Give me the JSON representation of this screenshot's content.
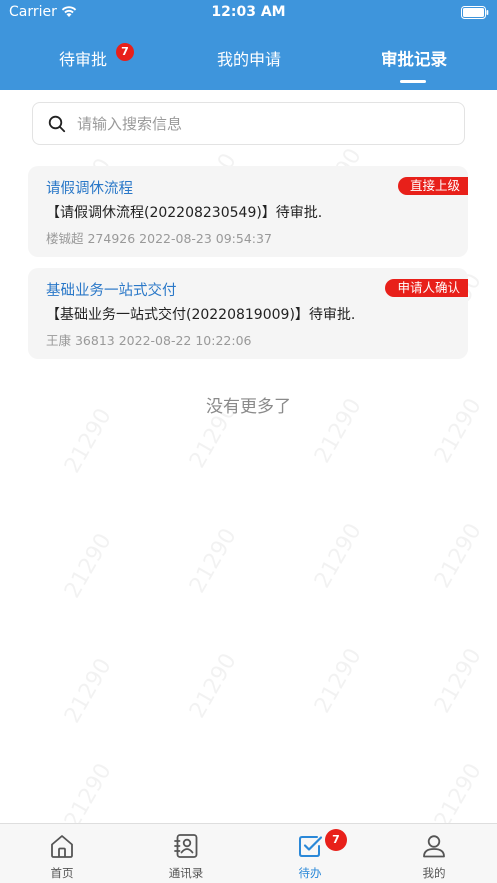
{
  "status_bar": {
    "carrier": "Carrier",
    "time": "12:03 AM"
  },
  "tabs": [
    {
      "label": "待审批",
      "badge": "7"
    },
    {
      "label": "我的申请"
    },
    {
      "label": "审批记录",
      "active": true
    }
  ],
  "search": {
    "placeholder": "请输入搜索信息",
    "value": ""
  },
  "records": [
    {
      "title": "请假调休流程",
      "tag": "直接上级",
      "description": "【请假调休流程(202208230549)】待审批.",
      "meta": "楼铖超 274926 2022-08-23 09:54:37"
    },
    {
      "title": "基础业务一站式交付",
      "tag": "申请人确认",
      "description": "【基础业务一站式交付(20220819009)】待审批.",
      "meta": "王康 36813 2022-08-22 10:22:06"
    }
  ],
  "no_more_text": "没有更多了",
  "watermark_text": "21290",
  "bottom_nav": [
    {
      "label": "首页",
      "icon": "home-icon"
    },
    {
      "label": "通讯录",
      "icon": "contacts-icon"
    },
    {
      "label": "待办",
      "icon": "todo-check-icon",
      "active": true,
      "badge": "7"
    },
    {
      "label": "我的",
      "icon": "profile-icon"
    }
  ],
  "colors": {
    "header_bg": "#3e95dc",
    "accent_blue": "#2a78c8",
    "badge_red": "#e8201a",
    "card_bg": "#f5f5f5"
  }
}
